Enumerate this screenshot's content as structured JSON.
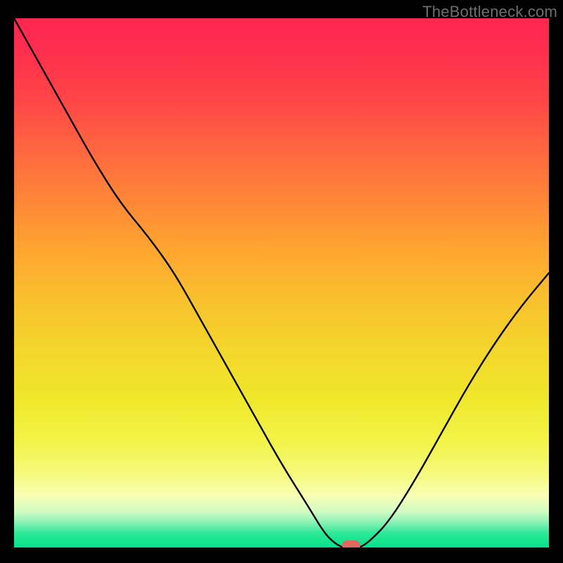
{
  "watermark": "TheBottleneck.com",
  "colors": {
    "background": "#000000",
    "curve": "#000000",
    "marker": "#e0685f",
    "gradient_top": "#ff2650",
    "gradient_bottom": "#00e389"
  },
  "chart_data": {
    "type": "line",
    "title": "",
    "xlabel": "",
    "ylabel": "",
    "xlim": [
      0,
      100
    ],
    "ylim": [
      0,
      100
    ],
    "x": [
      0,
      5,
      10,
      15,
      20,
      25,
      30,
      35,
      40,
      45,
      50,
      55,
      58,
      60,
      62,
      64,
      66,
      70,
      75,
      80,
      85,
      90,
      95,
      100
    ],
    "values": [
      100,
      91,
      82,
      73,
      65,
      59,
      52,
      43,
      34,
      25,
      16,
      8,
      3,
      1,
      0,
      0,
      1,
      5,
      13,
      22,
      31,
      39,
      46,
      52
    ],
    "marker": {
      "x": 63,
      "y": 0
    },
    "notes": "V-shaped bottleneck curve over a vertical red-to-green gradient. Y-axis roughly represents bottleneck percentage (100=severe red, 0=optimal green). X-axis is an unlabeled component-balance scale. Values estimated from pixel positions."
  }
}
